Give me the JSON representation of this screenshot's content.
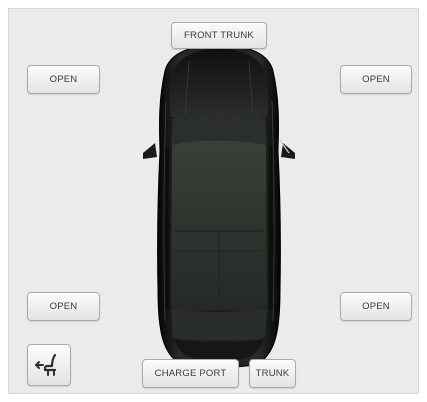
{
  "buttons": {
    "front_trunk": "FRONT TRUNK",
    "front_left_door": "OPEN",
    "front_right_door": "OPEN",
    "rear_left_door": "OPEN",
    "rear_right_door": "OPEN",
    "charge_port": "CHARGE PORT",
    "trunk": "TRUNK"
  },
  "icons": {
    "seat_adjust": "seat-adjust-icon",
    "car": "car-top-view"
  },
  "colors": {
    "panel_background": "#ebebeb",
    "car_body": "#1b1b1b",
    "button_text": "#3a3a3a"
  }
}
